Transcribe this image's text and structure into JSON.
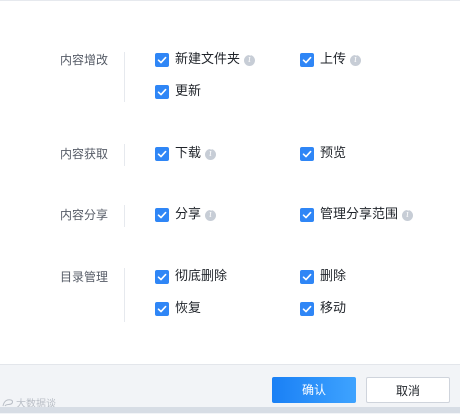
{
  "permissions": {
    "sections": [
      {
        "title": "内容增改",
        "options": [
          {
            "label": "新建文件夹",
            "checked": true,
            "info": true
          },
          {
            "label": "上传",
            "checked": true,
            "info": true
          },
          {
            "label": "更新",
            "checked": true,
            "info": false
          }
        ]
      },
      {
        "title": "内容获取",
        "options": [
          {
            "label": "下载",
            "checked": true,
            "info": true
          },
          {
            "label": "预览",
            "checked": true,
            "info": false
          }
        ]
      },
      {
        "title": "内容分享",
        "options": [
          {
            "label": "分享",
            "checked": true,
            "info": true
          },
          {
            "label": "管理分享范围",
            "checked": true,
            "info": true
          }
        ]
      },
      {
        "title": "目录管理",
        "options": [
          {
            "label": "彻底删除",
            "checked": true,
            "info": false
          },
          {
            "label": "删除",
            "checked": true,
            "info": false
          },
          {
            "label": "恢复",
            "checked": true,
            "info": false
          },
          {
            "label": "移动",
            "checked": true,
            "info": false
          }
        ]
      }
    ]
  },
  "footer": {
    "confirm_label": "确认",
    "cancel_label": "取消",
    "watermark_text": "大数据谈"
  },
  "colors": {
    "checkbox": "#2f86f6",
    "confirm_button": "#1a80f5"
  },
  "icons": {
    "info": "info-icon",
    "check": "check-icon",
    "watermark": "watermark-logo-icon"
  }
}
